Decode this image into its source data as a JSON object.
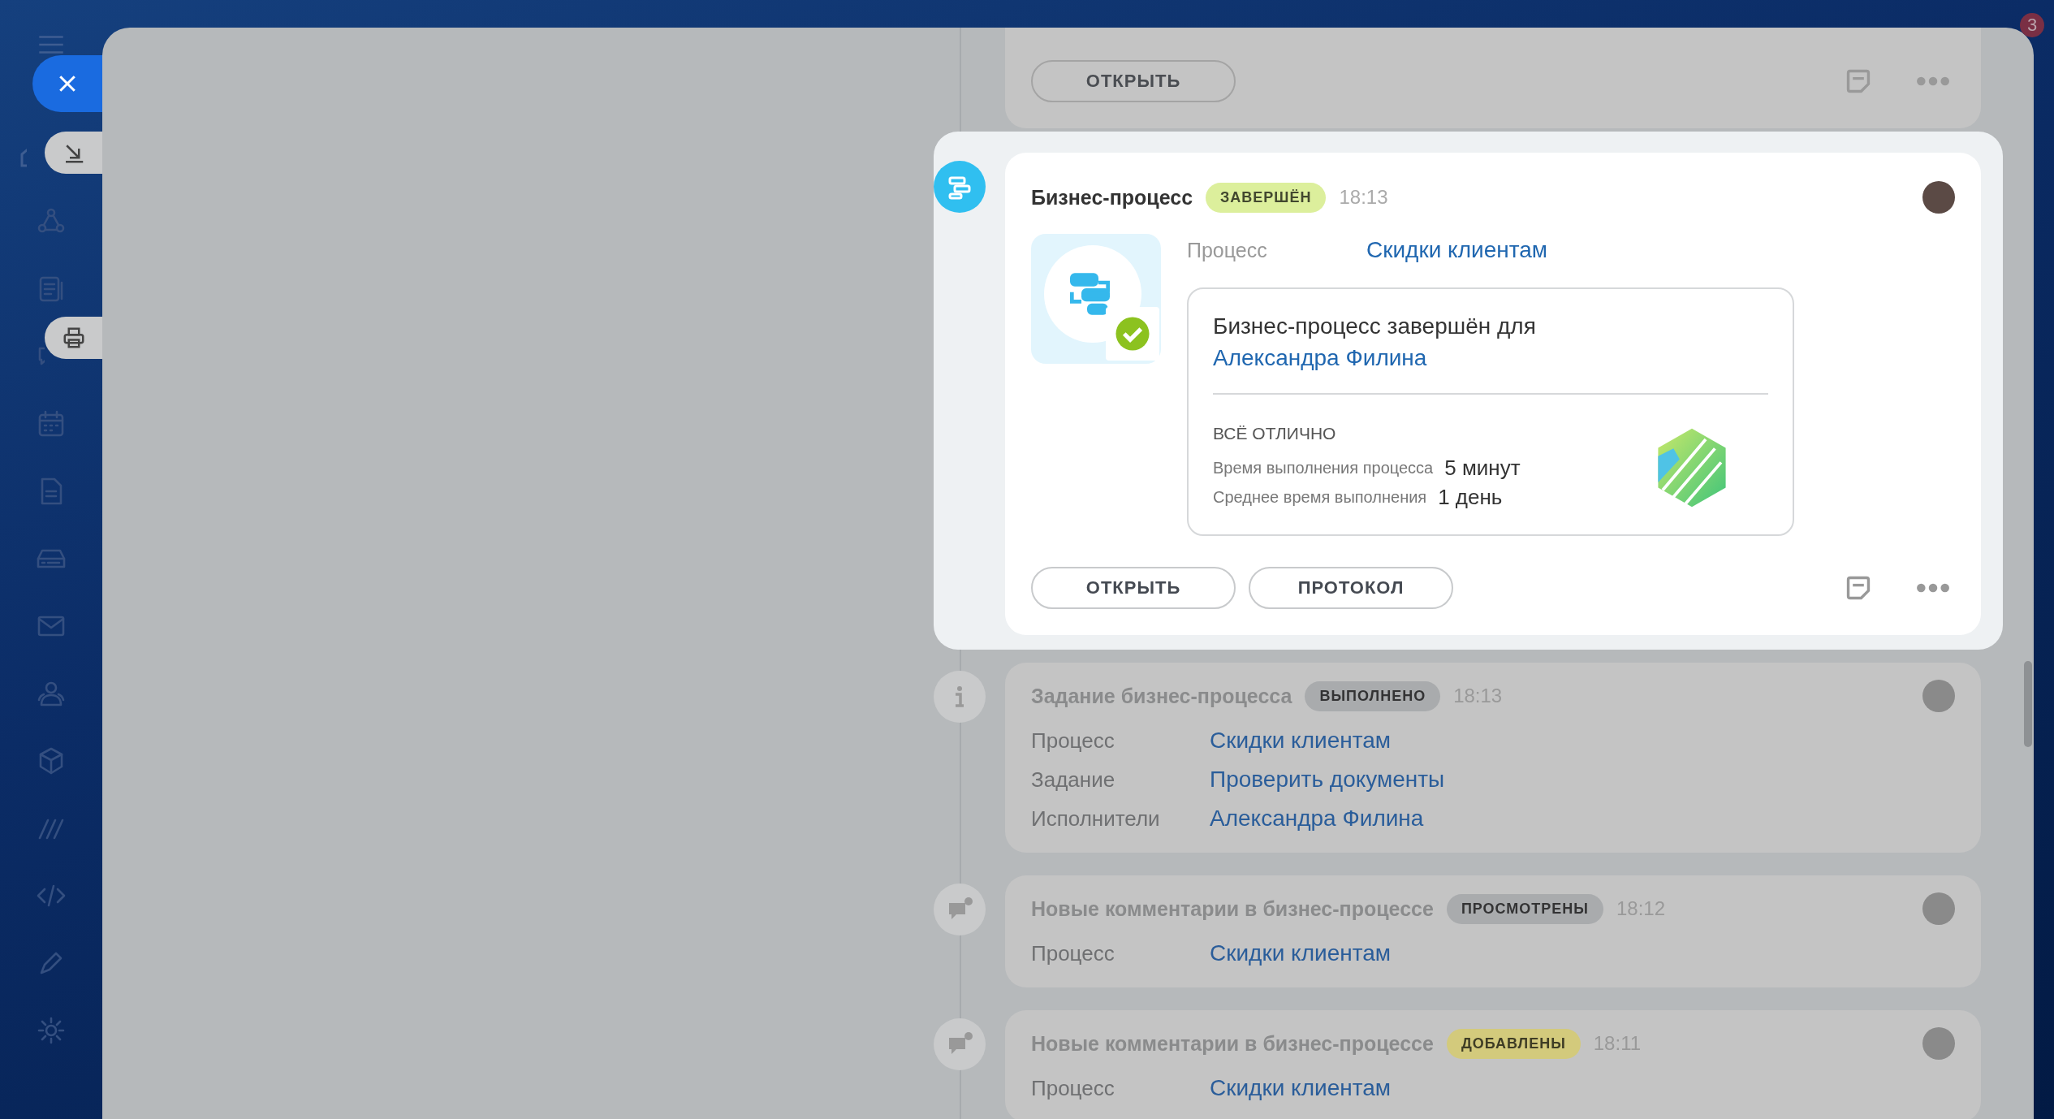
{
  "notification_badge": "3",
  "timeline": [
    {
      "highlighted": false,
      "cut_top": true,
      "buttons": [
        "ОТКРЫТЬ"
      ]
    },
    {
      "kind": "business_process",
      "highlighted": true,
      "title": "Бизнес-процесс",
      "status": {
        "label": "ЗАВЕРШЁН",
        "color": "#dcef9c"
      },
      "time": "18:13",
      "process_label": "Процесс",
      "process_value": "Скидки клиентам",
      "message": "Бизнес-процесс завершён для",
      "message_link": "Александра Филина",
      "rating_title": "ВСЁ ОТЛИЧНО",
      "stats": [
        {
          "label": "Время выполнения процесса",
          "value": "5 минут"
        },
        {
          "label": "Среднее время выполнения",
          "value": "1 день"
        }
      ],
      "buttons": [
        "ОТКРЫТЬ",
        "ПРОТОКОЛ"
      ]
    },
    {
      "kind": "task",
      "highlighted": false,
      "title": "Задание бизнес-процесса",
      "status": {
        "label": "ВЫПОЛНЕНО",
        "color": "#a9abad"
      },
      "time": "18:13",
      "fields": [
        {
          "label": "Процесс",
          "value": "Скидки клиентам"
        },
        {
          "label": "Задание",
          "value": "Проверить документы"
        },
        {
          "label": "Исполнители",
          "value": "Александра Филина"
        }
      ]
    },
    {
      "kind": "comment",
      "highlighted": false,
      "title": "Новые комментарии в бизнес-процессе",
      "status": {
        "label": "ПРОСМОТРЕНЫ",
        "color": "#a9abad"
      },
      "time": "18:12",
      "fields": [
        {
          "label": "Процесс",
          "value": "Скидки клиентам"
        }
      ]
    },
    {
      "kind": "comment",
      "highlighted": false,
      "title": "Новые комментарии в бизнес-процессе",
      "status": {
        "label": "ДОБАВЛЕНЫ",
        "color": "#d3ca7c"
      },
      "time": "18:11",
      "fields": [
        {
          "label": "Процесс",
          "value": "Скидки клиентам"
        }
      ]
    }
  ]
}
